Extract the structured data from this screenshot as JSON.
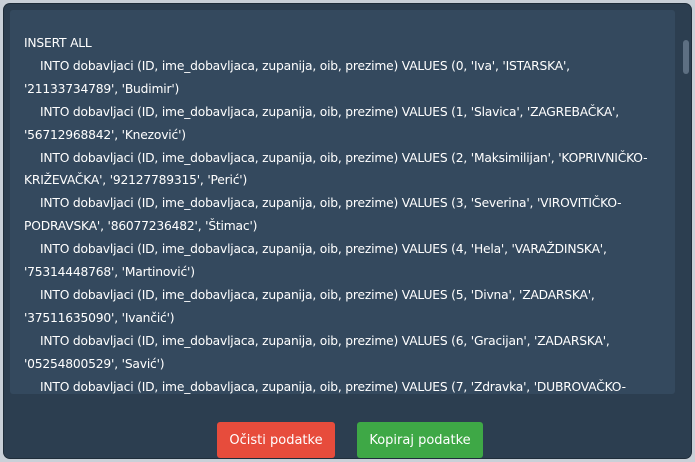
{
  "output": {
    "header": "INSERT ALL",
    "rows": [
      "INTO dobavljaci (ID, ime_dobavljaca, zupanija, oib, prezime) VALUES (0, 'Iva', 'ISTARSKA', '21133734789', 'Budimir')",
      "INTO dobavljaci (ID, ime_dobavljaca, zupanija, oib, prezime) VALUES (1, 'Slavica', 'ZAGREBAČKA', '56712968842', 'Knezović')",
      "INTO dobavljaci (ID, ime_dobavljaca, zupanija, oib, prezime) VALUES (2, 'Maksimilijan', 'KOPRIVNIČKO-KRIŽEVAČKA', '92127789315', 'Perić')",
      "INTO dobavljaci (ID, ime_dobavljaca, zupanija, oib, prezime) VALUES (3, 'Severina', 'VIROVITIČKO-PODRAVSKA', '86077236482', 'Štimac')",
      "INTO dobavljaci (ID, ime_dobavljaca, zupanija, oib, prezime) VALUES (4, 'Hela', 'VARAŽDINSKA', '75314448768', 'Martinović')",
      "INTO dobavljaci (ID, ime_dobavljaca, zupanija, oib, prezime) VALUES (5, 'Divna', 'ZADARSKA', '37511635090', 'Ivančić')",
      "INTO dobavljaci (ID, ime_dobavljaca, zupanija, oib, prezime) VALUES (6, 'Gracijan', 'ZADARSKA', '05254800529', 'Savić')",
      "INTO dobavljaci (ID, ime_dobavljaca, zupanija, oib, prezime) VALUES (7, 'Zdravka', 'DUBROVAČKO-"
    ]
  },
  "buttons": {
    "clear_label": "Očisti podatke",
    "copy_label": "Kopiraj podatke"
  },
  "colors": {
    "background": "#2c3e50",
    "output_panel": "#34495e",
    "clear_button": "#e74c3c",
    "copy_button": "#3ea846",
    "text": "#ffffff"
  }
}
